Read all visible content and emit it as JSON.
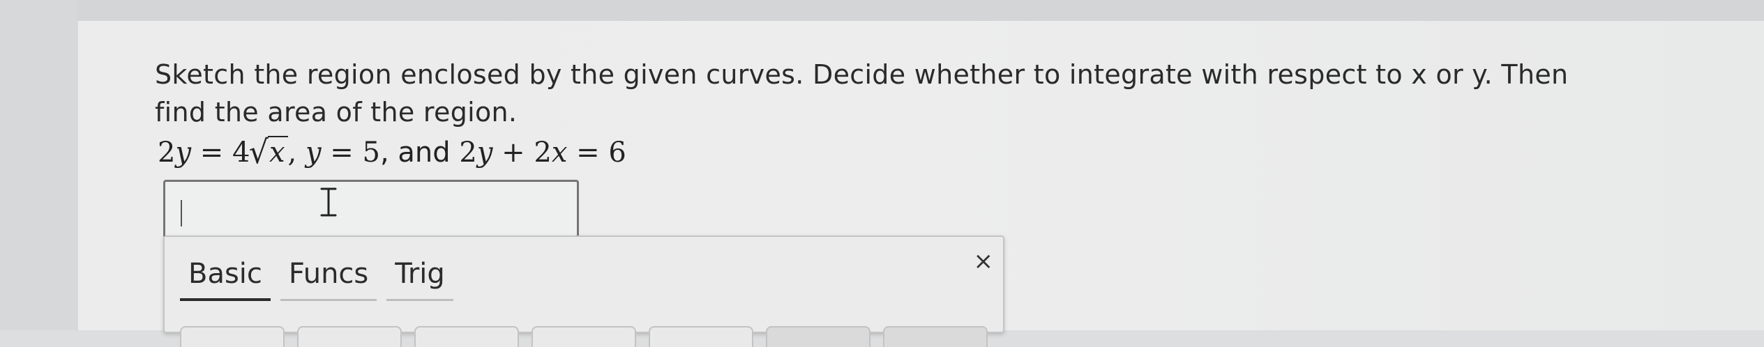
{
  "question": {
    "line1": "Sketch the region enclosed by the given curves. Decide whether to integrate with respect to x or y. Then",
    "line2": "find the area of the region."
  },
  "equation": {
    "eq1_lhs": "2",
    "eq1_var": "y",
    "eq1_eq": " = 4",
    "eq1_radicand": "x",
    "sep1": ", ",
    "eq2_var": "y",
    "eq2_rest": " = 5",
    "sep2": ", and ",
    "eq3_a": "2",
    "eq3_var1": "y",
    "eq3_plus": " + 2",
    "eq3_var2": "x",
    "eq3_rest": " = 6"
  },
  "answer": {
    "value": ""
  },
  "keypad": {
    "tabs": [
      {
        "label": "Basic",
        "active": true
      },
      {
        "label": "Funcs",
        "active": false
      },
      {
        "label": "Trig",
        "active": false
      }
    ],
    "close_label": "×"
  },
  "colors": {
    "background": "#ececec",
    "text": "#2b2b2b",
    "input_border": "#757575"
  }
}
